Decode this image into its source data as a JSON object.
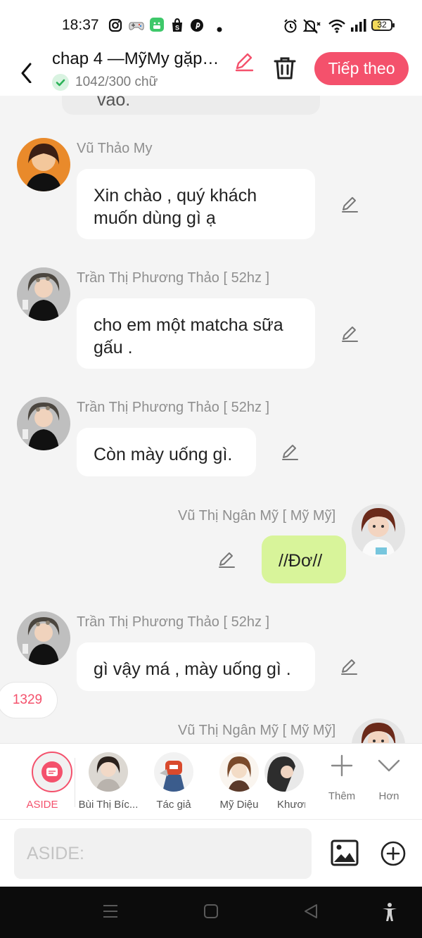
{
  "status_bar": {
    "time": "18:37",
    "battery": "32",
    "icons": [
      "instagram-icon",
      "game-controller-icon",
      "android-app-icon",
      "shopee-icon",
      "pinterest-icon",
      "dot-icon",
      "alarm-icon",
      "mute-icon",
      "wifi-icon",
      "signal-icon",
      "battery-icon"
    ]
  },
  "header": {
    "title": "chap 4 —MỹMy gặp…",
    "word_count": "1042/300 chữ",
    "next_label": "Tiếp theo"
  },
  "chat": {
    "partial_top_text": "vào.",
    "messages": [
      {
        "author": "Vũ Thảo My",
        "text": "Xin chào , quý khách muốn dùng gì ạ",
        "side": "left"
      },
      {
        "author": "Trần Thị Phương Thảo [ 52hz ]",
        "text": "cho em một matcha sữa gấu .",
        "side": "left"
      },
      {
        "author": "Trần Thị Phương Thảo [ 52hz ]",
        "text": "Còn mày uống gì.",
        "side": "left"
      },
      {
        "author": "Vũ Thị Ngân Mỹ [ Mỹ Mỹ]",
        "text": "//Đơ//",
        "side": "right"
      },
      {
        "author": "Trần Thị Phương Thảo [ 52hz ]",
        "text": "gì vậy má , mày uống gì .",
        "side": "left"
      },
      {
        "author": "Vũ Thị Ngân Mỹ [ Mỹ Mỹ]",
        "text": "",
        "side": "right"
      }
    ],
    "float_badge": "1329"
  },
  "character_bar": {
    "aside_label": "ASIDE",
    "characters": [
      {
        "label": "Bùi Thị Bíc..."
      },
      {
        "label": "Tác giả"
      },
      {
        "label": "Mỹ Diệu"
      },
      {
        "label": "Khươn"
      }
    ],
    "add_label": "Thêm",
    "more_label": "Hơn"
  },
  "input": {
    "placeholder": "ASIDE:"
  },
  "colors": {
    "accent": "#f4516c",
    "my_bubble": "#d8f49a",
    "background": "#f4f4f4",
    "name_gray": "#8f8f8f"
  }
}
